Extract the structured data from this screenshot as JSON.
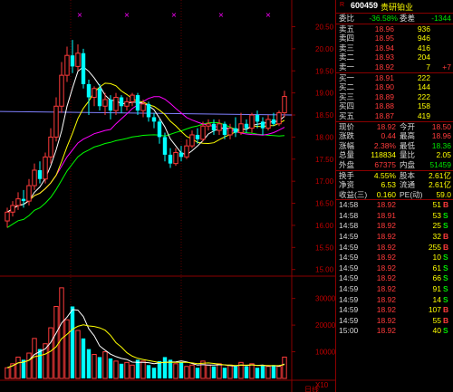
{
  "chart_data": {
    "type": "candlestick",
    "price_axis": {
      "ticks": [
        "20.50",
        "20.00",
        "19.50",
        "19.00",
        "18.50",
        "18.00",
        "17.50",
        "17.00",
        "16.50",
        "16.00",
        "15.50",
        "15.00"
      ]
    },
    "volume_axis": {
      "ticks": [
        "30000",
        "20000",
        "10000"
      ],
      "unit": "X10"
    },
    "candles": [
      {
        "o": 16.1,
        "c": 16.3,
        "h": 16.4,
        "l": 15.95
      },
      {
        "o": 16.3,
        "c": 16.45,
        "h": 16.55,
        "l": 16.2
      },
      {
        "o": 16.45,
        "c": 16.6,
        "h": 16.75,
        "l": 16.35
      },
      {
        "o": 16.6,
        "c": 16.55,
        "h": 16.8,
        "l": 16.4
      },
      {
        "o": 16.55,
        "c": 16.9,
        "h": 17.05,
        "l": 16.45
      },
      {
        "o": 16.9,
        "c": 17.25,
        "h": 17.4,
        "l": 16.8
      },
      {
        "o": 17.25,
        "c": 17.05,
        "h": 17.45,
        "l": 16.95
      },
      {
        "o": 17.05,
        "c": 17.55,
        "h": 17.65,
        "l": 16.95
      },
      {
        "o": 17.55,
        "c": 18.0,
        "h": 18.2,
        "l": 17.4
      },
      {
        "o": 18.0,
        "c": 18.7,
        "h": 18.9,
        "l": 17.9
      },
      {
        "o": 18.7,
        "c": 19.4,
        "h": 19.7,
        "l": 18.55
      },
      {
        "o": 19.4,
        "c": 19.85,
        "h": 20.05,
        "l": 19.25
      },
      {
        "o": 19.85,
        "c": 19.6,
        "h": 20.2,
        "l": 19.45
      },
      {
        "o": 19.6,
        "c": 19.9,
        "h": 20.1,
        "l": 19.5
      },
      {
        "o": 19.9,
        "c": 19.2,
        "h": 20.0,
        "l": 19.1
      },
      {
        "o": 19.2,
        "c": 18.9,
        "h": 19.3,
        "l": 18.5
      },
      {
        "o": 18.9,
        "c": 19.1,
        "h": 19.15,
        "l": 18.7
      },
      {
        "o": 19.1,
        "c": 18.7,
        "h": 19.2,
        "l": 18.6
      },
      {
        "o": 18.7,
        "c": 18.85,
        "h": 19.0,
        "l": 18.5
      },
      {
        "o": 18.85,
        "c": 18.6,
        "h": 18.95,
        "l": 18.4
      },
      {
        "o": 18.6,
        "c": 18.9,
        "h": 19.0,
        "l": 18.5
      },
      {
        "o": 18.9,
        "c": 18.7,
        "h": 18.95,
        "l": 18.55
      },
      {
        "o": 18.7,
        "c": 18.8,
        "h": 18.9,
        "l": 18.6
      },
      {
        "o": 18.8,
        "c": 18.95,
        "h": 19.0,
        "l": 18.7
      },
      {
        "o": 18.95,
        "c": 18.6,
        "h": 19.0,
        "l": 18.5
      },
      {
        "o": 18.6,
        "c": 18.75,
        "h": 18.85,
        "l": 18.45
      },
      {
        "o": 18.75,
        "c": 18.45,
        "h": 18.8,
        "l": 18.35
      },
      {
        "o": 18.45,
        "c": 18.35,
        "h": 18.55,
        "l": 18.2
      },
      {
        "o": 18.35,
        "c": 18.0,
        "h": 18.4,
        "l": 17.85
      },
      {
        "o": 18.0,
        "c": 17.6,
        "h": 18.1,
        "l": 17.45
      },
      {
        "o": 17.6,
        "c": 17.4,
        "h": 17.75,
        "l": 17.3
      },
      {
        "o": 17.4,
        "c": 17.65,
        "h": 17.75,
        "l": 17.35
      },
      {
        "o": 17.65,
        "c": 17.55,
        "h": 17.8,
        "l": 17.45
      },
      {
        "o": 17.55,
        "c": 17.8,
        "h": 17.95,
        "l": 17.5
      },
      {
        "o": 17.8,
        "c": 18.05,
        "h": 18.15,
        "l": 17.75
      },
      {
        "o": 18.05,
        "c": 17.95,
        "h": 18.2,
        "l": 17.85
      },
      {
        "o": 17.95,
        "c": 18.25,
        "h": 18.35,
        "l": 17.9
      },
      {
        "o": 18.25,
        "c": 18.3,
        "h": 18.4,
        "l": 18.15
      },
      {
        "o": 18.3,
        "c": 18.15,
        "h": 18.4,
        "l": 18.05
      },
      {
        "o": 18.15,
        "c": 18.3,
        "h": 18.4,
        "l": 18.05
      },
      {
        "o": 18.3,
        "c": 18.05,
        "h": 18.35,
        "l": 17.95
      },
      {
        "o": 18.05,
        "c": 18.2,
        "h": 18.3,
        "l": 17.95
      },
      {
        "o": 18.2,
        "c": 18.1,
        "h": 18.45,
        "l": 18.0
      },
      {
        "o": 18.1,
        "c": 18.3,
        "h": 18.55,
        "l": 18.05
      },
      {
        "o": 18.3,
        "c": 18.2,
        "h": 18.4,
        "l": 18.1
      },
      {
        "o": 18.2,
        "c": 18.5,
        "h": 18.55,
        "l": 18.1
      },
      {
        "o": 18.5,
        "c": 18.35,
        "h": 18.6,
        "l": 18.2
      },
      {
        "o": 18.35,
        "c": 18.2,
        "h": 18.45,
        "l": 18.05
      },
      {
        "o": 18.2,
        "c": 18.4,
        "h": 18.5,
        "l": 18.15
      },
      {
        "o": 18.4,
        "c": 18.3,
        "h": 18.55,
        "l": 18.25
      },
      {
        "o": 18.3,
        "c": 18.55,
        "h": 18.6,
        "l": 18.25
      },
      {
        "o": 18.55,
        "c": 18.92,
        "h": 19.05,
        "l": 18.45
      }
    ],
    "volumes": [
      4000,
      5500,
      8000,
      7000,
      9500,
      15000,
      11000,
      13000,
      19000,
      27000,
      34000,
      22000,
      27000,
      18000,
      15000,
      11000,
      9000,
      8000,
      10000,
      7500,
      6500,
      5500,
      6000,
      5000,
      7000,
      6500,
      5000,
      4000,
      6500,
      8000,
      7000,
      5500,
      6000,
      4500,
      5000,
      4000,
      6500,
      5000,
      4500,
      5500,
      4000,
      5000,
      4500,
      6000,
      4500,
      5500,
      4000,
      5000,
      4500,
      5000,
      4500,
      8000
    ],
    "ma_colors": {
      "ma5": "#ffffff",
      "ma10": "#ffff00",
      "ma20": "#ff00ff",
      "ma60": "#00ff00",
      "ref": "#8080ff"
    }
  },
  "quote": {
    "r_label": "R",
    "code": "600459",
    "name": "贵研铂业",
    "weibi": {
      "label": "委比",
      "value": "-36.58%",
      "label2": "委差",
      "value2": "-1344"
    },
    "asks": [
      {
        "label": "卖五",
        "price": "18.96",
        "vol": "936",
        "chg": ""
      },
      {
        "label": "卖四",
        "price": "18.95",
        "vol": "946",
        "chg": ""
      },
      {
        "label": "卖三",
        "price": "18.94",
        "vol": "416",
        "chg": ""
      },
      {
        "label": "卖二",
        "price": "18.93",
        "vol": "204",
        "chg": ""
      },
      {
        "label": "卖一",
        "price": "18.92",
        "vol": "7",
        "chg": "+7"
      }
    ],
    "bids": [
      {
        "label": "买一",
        "price": "18.91",
        "vol": "222"
      },
      {
        "label": "买二",
        "price": "18.90",
        "vol": "144"
      },
      {
        "label": "买三",
        "price": "18.89",
        "vol": "222"
      },
      {
        "label": "买四",
        "price": "18.88",
        "vol": "158"
      },
      {
        "label": "买五",
        "price": "18.87",
        "vol": "419"
      }
    ],
    "stats": [
      {
        "l1": "现价",
        "v1": "18.92",
        "c1": "red",
        "l2": "今开",
        "v2": "18.50",
        "c2": "red"
      },
      {
        "l1": "涨跌",
        "v1": "0.44",
        "c1": "red",
        "l2": "最高",
        "v2": "18.96",
        "c2": "red"
      },
      {
        "l1": "涨幅",
        "v1": "2.38%",
        "c1": "red",
        "l2": "最低",
        "v2": "18.36",
        "c2": "green"
      },
      {
        "l1": "总量",
        "v1": "118834",
        "c1": "yellow",
        "l2": "量比",
        "v2": "2.05",
        "c2": "yellow"
      },
      {
        "l1": "外盘",
        "v1": "67375",
        "c1": "red",
        "l2": "内盘",
        "v2": "51459",
        "c2": "green"
      }
    ],
    "stats2": [
      {
        "l1": "换手",
        "v1": "4.55%",
        "l2": "股本",
        "v2": "2.61亿"
      },
      {
        "l1": "净资",
        "v1": "6.53",
        "l2": "流通",
        "v2": "2.61亿"
      },
      {
        "l1": "收益(三)",
        "v1": "0.160",
        "l2": "PE(动)",
        "v2": "59.0"
      }
    ],
    "ticks": [
      {
        "time": "14:58",
        "price": "18.92",
        "vol": "51",
        "side": "B"
      },
      {
        "time": "14:58",
        "price": "18.91",
        "vol": "53",
        "side": "S"
      },
      {
        "time": "14:58",
        "price": "18.92",
        "vol": "25",
        "side": "S"
      },
      {
        "time": "14:59",
        "price": "18.92",
        "vol": "32",
        "side": "B"
      },
      {
        "time": "14:59",
        "price": "18.92",
        "vol": "255",
        "side": "B"
      },
      {
        "time": "14:59",
        "price": "18.92",
        "vol": "10",
        "side": "S"
      },
      {
        "time": "14:59",
        "price": "18.92",
        "vol": "61",
        "side": "S"
      },
      {
        "time": "14:59",
        "price": "18.92",
        "vol": "66",
        "side": "S"
      },
      {
        "time": "14:59",
        "price": "18.92",
        "vol": "91",
        "side": "S"
      },
      {
        "time": "14:59",
        "price": "18.92",
        "vol": "14",
        "side": "S"
      },
      {
        "time": "14:59",
        "price": "18.92",
        "vol": "107",
        "side": "B"
      },
      {
        "time": "14:59",
        "price": "18.92",
        "vol": "55",
        "side": "B"
      },
      {
        "time": "15:00",
        "price": "18.92",
        "vol": "40",
        "side": "S"
      }
    ]
  },
  "footer": {
    "volume_unit_label": "X10",
    "bottom_left_label": "日线"
  }
}
